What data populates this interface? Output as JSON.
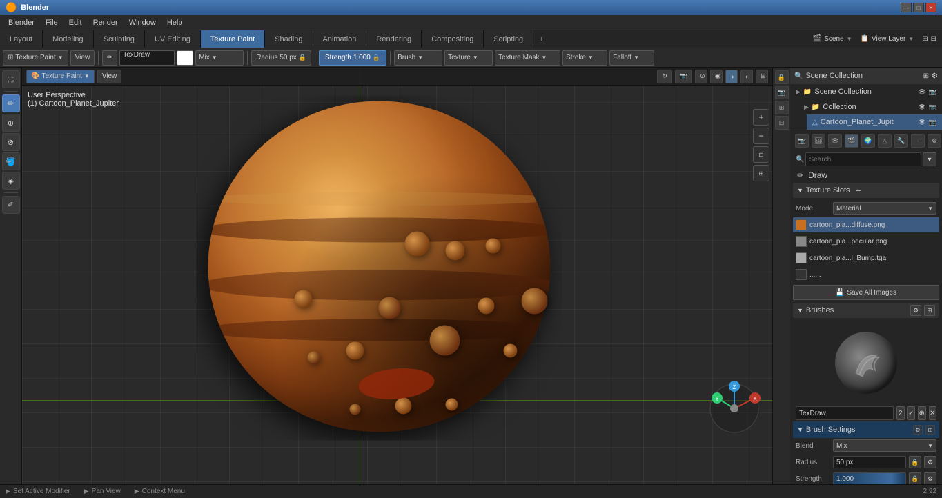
{
  "titlebar": {
    "title": "Blender",
    "controls": [
      "—",
      "□",
      "✕"
    ]
  },
  "menubar": {
    "items": [
      "Blender",
      "File",
      "Edit",
      "Render",
      "Window",
      "Help"
    ]
  },
  "tabs": {
    "items": [
      {
        "label": "Layout",
        "active": false
      },
      {
        "label": "Modeling",
        "active": false
      },
      {
        "label": "Sculpting",
        "active": false
      },
      {
        "label": "UV Editing",
        "active": false
      },
      {
        "label": "Texture Paint",
        "active": true
      },
      {
        "label": "Shading",
        "active": false
      },
      {
        "label": "Animation",
        "active": false
      },
      {
        "label": "Rendering",
        "active": false
      },
      {
        "label": "Compositing",
        "active": false
      },
      {
        "label": "Scripting",
        "active": false
      }
    ],
    "plus": "+",
    "scene_label": "Scene",
    "view_layer_label": "View Layer"
  },
  "toolbar": {
    "mode_label": "Texture Paint",
    "view_label": "View",
    "brush_name": "TexDraw",
    "mix_label": "Mix",
    "radius_label": "Radius",
    "radius_value": "50 px",
    "strength_label": "Strength",
    "strength_value": "1.000",
    "brush_label": "Brush",
    "texture_label": "Texture",
    "texture_mask_label": "Texture Mask",
    "stroke_label": "Stroke",
    "falloff_label": "Falloff"
  },
  "tools": {
    "items": [
      {
        "icon": "◻",
        "label": "select",
        "active": false
      },
      {
        "icon": "✏",
        "label": "draw",
        "active": true
      },
      {
        "icon": "⊕",
        "label": "soften",
        "active": false
      },
      {
        "icon": "⊗",
        "label": "smear",
        "active": false
      },
      {
        "icon": "🪣",
        "label": "fill",
        "active": false
      },
      {
        "icon": "◈",
        "label": "mask",
        "active": false
      },
      {
        "icon": "✐",
        "label": "annotate",
        "active": false
      }
    ]
  },
  "viewport": {
    "perspective_label": "User Perspective",
    "object_label": "(1) Cartoon_Planet_Jupiter",
    "header_buttons": [
      "Texture Paint",
      "View"
    ]
  },
  "outliner": {
    "title": "Scene Collection",
    "scene_collection": "Scene Collection",
    "collection": "Collection",
    "object": "Cartoon_Planet_Jupit"
  },
  "properties": {
    "search_placeholder": "Search",
    "draw_label": "Draw",
    "texture_slots_label": "Texture Slots",
    "mode_label": "Mode",
    "mode_value": "Material",
    "textures": [
      {
        "name": "cartoon_pla...diffuse.png",
        "color": "orange",
        "active": true
      },
      {
        "name": "cartoon_pla...pecular.png",
        "color": "gray",
        "active": false
      },
      {
        "name": "cartoon_pla...l_Bump.tga",
        "color": "lightgray",
        "active": false
      },
      {
        "name": "......",
        "color": "none",
        "active": false
      }
    ],
    "save_all_label": "Save All Images",
    "brushes_label": "Brushes",
    "brush_name": "TexDraw",
    "brush_num": "2",
    "brush_settings_label": "Brush Settings",
    "blend_label": "Blend",
    "blend_value": "Mix",
    "radius_label": "Radius",
    "radius_value": "50 px",
    "strength_label": "Strength",
    "strength_value": "1.000"
  },
  "statusbar": {
    "item1": "Set Active Modifier",
    "item2": "Pan View",
    "item3": "Context Menu",
    "value": "2.92"
  },
  "colors": {
    "accent": "#3d6b9e",
    "active_tab": "#3d6b9e",
    "orange_texture": "#c87020",
    "bg_dark": "#1a1a1a",
    "bg_medium": "#2a2a2a",
    "bg_light": "#333333"
  }
}
